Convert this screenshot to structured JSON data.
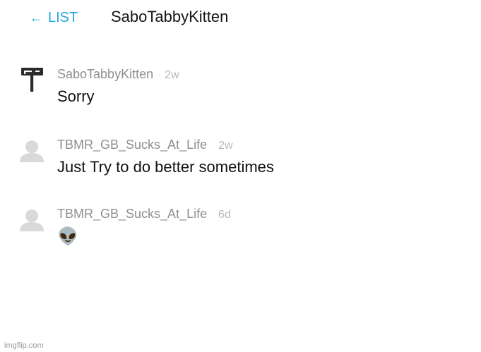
{
  "header": {
    "back_label": "LIST",
    "back_arrow": "←",
    "title": "SaboTabbyKitten"
  },
  "messages": [
    {
      "username": "SaboTabbyKitten",
      "time": "2w",
      "text": "Sorry",
      "avatar_icon": "signpost-icon"
    },
    {
      "username": "TBMR_GB_Sucks_At_Life",
      "time": "2w",
      "text": "Just Try to do better sometimes",
      "avatar_icon": "default-user-icon"
    },
    {
      "username": "TBMR_GB_Sucks_At_Life",
      "time": "6d",
      "text": "👽",
      "avatar_icon": "default-user-icon"
    }
  ],
  "footer": {
    "watermark": "imgflip.com"
  },
  "colors": {
    "accent": "#27a8e0",
    "username": "#8f8f8f",
    "timestamp": "#b8b8b8",
    "text": "#111111",
    "avatar_placeholder": "#d9d9d9",
    "signpost": "#2b2b2b"
  }
}
